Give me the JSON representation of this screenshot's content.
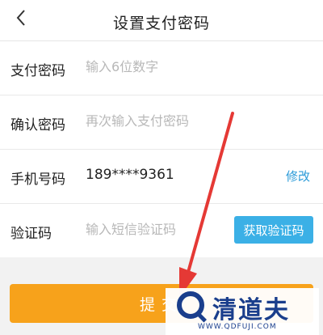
{
  "header": {
    "title": "设置支付密码",
    "back_icon": "chevron-left-icon"
  },
  "form": {
    "pay_password": {
      "label": "支付密码",
      "placeholder": "输入6位数字"
    },
    "confirm_password": {
      "label": "确认密码",
      "placeholder": "再次输入支付密码"
    },
    "phone": {
      "label": "手机号码",
      "value": "189****9361",
      "action_label": "修改"
    },
    "verify_code": {
      "label": "验证码",
      "placeholder": "输入短信验证码",
      "action_label": "获取验证码"
    }
  },
  "submit": {
    "label": "提交"
  },
  "watermark": {
    "name": "清道夫",
    "url": "WWW.QDFUJI.COM"
  },
  "colors": {
    "accent_orange": "#f7a21b",
    "accent_blue": "#3bb0e6",
    "link_blue": "#2a9ad8",
    "annotation_red": "#e53935",
    "watermark_blue": "#1a3e8c"
  }
}
